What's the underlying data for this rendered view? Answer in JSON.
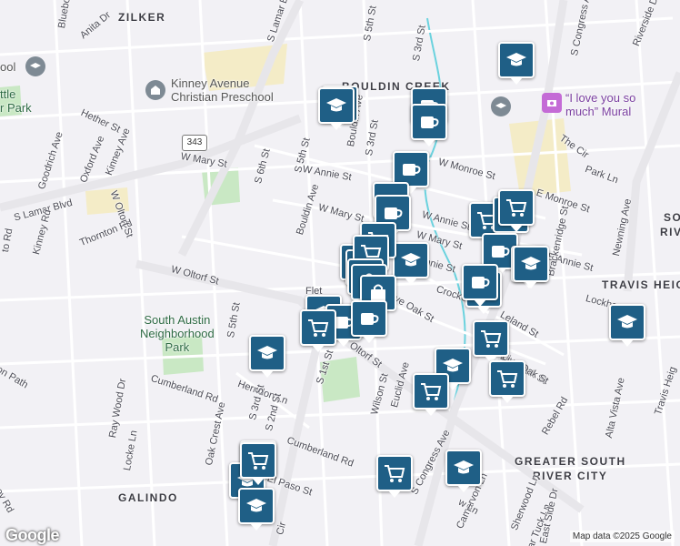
{
  "map": {
    "areas": [
      {
        "name": "ZILKER"
      },
      {
        "name": "BOULDIN CREEK"
      },
      {
        "name": "TRAVIS HEIG"
      },
      {
        "name": "SO"
      },
      {
        "name": "RIVE"
      },
      {
        "name": "GREATER SOUTH"
      },
      {
        "name": "RIVER CITY"
      },
      {
        "name": "GALINDO"
      }
    ],
    "pois": [
      {
        "name": "Kinney Avenue\nChristian Preschool"
      },
      {
        "name": "South Austin\nNeighborhood\nPark"
      },
      {
        "name": "ttle\nr Park"
      },
      {
        "name": "ool"
      },
      {
        "name": "“I love you so\nmuch” Mural"
      }
    ],
    "streets": [
      {
        "text": "Bluebonnet"
      },
      {
        "text": "Anita Dr"
      },
      {
        "text": "S Lamar B"
      },
      {
        "text": "S 5th St"
      },
      {
        "text": "S 3rd St"
      },
      {
        "text": "S Congress Av"
      },
      {
        "text": "Riverside Dr"
      },
      {
        "text": "Hether St"
      },
      {
        "text": "Kinney Ave"
      },
      {
        "text": "Oxford Ave"
      },
      {
        "text": "Goodrich Ave"
      },
      {
        "text": "S Lamar Blvd"
      },
      {
        "text": "W Mary St"
      },
      {
        "text": "Kinney Rd"
      },
      {
        "text": "Thornton Rd"
      },
      {
        "text": "W Oltorf St"
      },
      {
        "text": "S 6th St"
      },
      {
        "text": "S 5th St"
      },
      {
        "text": "W Annie St"
      },
      {
        "text": "Bouldin Ave"
      },
      {
        "text": "S 3rd St"
      },
      {
        "text": "Bouldin Ave"
      },
      {
        "text": "W Mary St"
      },
      {
        "text": "W Monroe St"
      },
      {
        "text": "E Monroe St"
      },
      {
        "text": "The Cir"
      },
      {
        "text": "Park Ln"
      },
      {
        "text": "W Annie St"
      },
      {
        "text": "W Mary St"
      },
      {
        "text": "Annie St"
      },
      {
        "text": "E Annie St"
      },
      {
        "text": "Newning Ave"
      },
      {
        "text": "Brackenridge St"
      },
      {
        "text": "Lockhart D"
      },
      {
        "text": "Crockett St"
      },
      {
        "text": "Leland St"
      },
      {
        "text": "Live Oak St"
      },
      {
        "text": "Live Oak St"
      },
      {
        "text": "W Oltorf St"
      },
      {
        "text": "W Oltorf St"
      },
      {
        "text": "S 1st St"
      },
      {
        "text": "S 5th St"
      },
      {
        "text": "Herndon Ln"
      },
      {
        "text": "Cumberland Rd"
      },
      {
        "text": "S 3rd St"
      },
      {
        "text": "S 2nd St"
      },
      {
        "text": "Oak Crest Ave"
      },
      {
        "text": "Wilson St"
      },
      {
        "text": "Euclid Ave"
      },
      {
        "text": "Cumberland Rd"
      },
      {
        "text": "El Paso St"
      },
      {
        "text": "S Congress Ave"
      },
      {
        "text": "Rebel Rd"
      },
      {
        "text": "Alta Vista Ave"
      },
      {
        "text": "Travis Heig"
      },
      {
        "text": "Ray Wood Dr"
      },
      {
        "text": "Locke Ln"
      },
      {
        "text": "Camarvon Ln"
      },
      {
        "text": "Sherwood Ln"
      },
      {
        "text": "ar Tuck Ln"
      },
      {
        "text": "East Side Dr"
      },
      {
        "text": "Flet"
      },
      {
        "text": "to Rd"
      },
      {
        "text": "on Path"
      },
      {
        "text": "sey Rd"
      },
      {
        "text": "Cir"
      },
      {
        "text": "w Ln"
      },
      {
        "text": "Live Oak St"
      }
    ],
    "highway_shield": "343",
    "markers": [
      {
        "type": "school"
      },
      {
        "type": "school"
      },
      {
        "type": "cafe"
      },
      {
        "type": "cafe"
      },
      {
        "type": "cafe"
      },
      {
        "type": "cafe"
      },
      {
        "type": "cafe"
      },
      {
        "type": "grocery"
      },
      {
        "type": "grocery"
      },
      {
        "type": "grocery"
      },
      {
        "type": "cafe"
      },
      {
        "type": "school"
      },
      {
        "type": "school"
      },
      {
        "type": "grocery"
      },
      {
        "type": "shopping"
      },
      {
        "type": "shopping"
      },
      {
        "type": "grocery"
      },
      {
        "type": "shopping"
      },
      {
        "type": "shopping"
      },
      {
        "type": "shopping"
      },
      {
        "type": "school"
      },
      {
        "type": "cafe"
      },
      {
        "type": "cafe"
      },
      {
        "type": "grocery"
      },
      {
        "type": "cafe"
      },
      {
        "type": "cafe"
      },
      {
        "type": "grocery"
      },
      {
        "type": "school"
      },
      {
        "type": "grocery"
      },
      {
        "type": "grocery"
      },
      {
        "type": "grocery"
      },
      {
        "type": "grocery"
      },
      {
        "type": "school"
      },
      {
        "type": "school"
      },
      {
        "type": "school"
      },
      {
        "type": "school"
      },
      {
        "type": "grocery"
      },
      {
        "type": "school"
      },
      {
        "type": "school"
      },
      {
        "type": "school"
      }
    ],
    "logo": "Google",
    "attribution": "Map data ©2025 Google",
    "colors": {
      "background": "#f2f1f5",
      "park": "#c9e8c4",
      "marker": "#1f5f86",
      "highway": "#e7e6ea",
      "water": "#6ad2de"
    }
  }
}
